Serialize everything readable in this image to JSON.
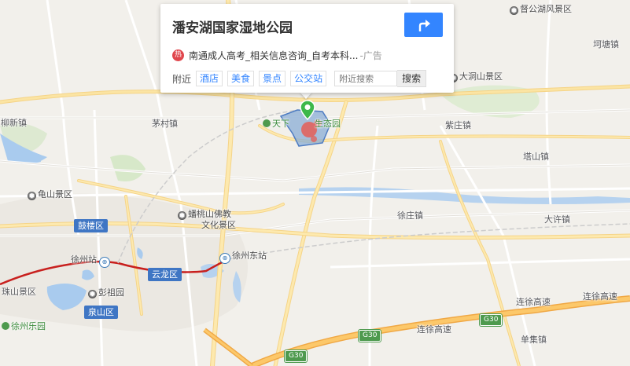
{
  "popup": {
    "title": "潘安湖国家湿地公园",
    "ad_icon": "热",
    "ad_text": "南通成人高考_相关信息咨询_自考本科...",
    "ad_mark": "-广告",
    "nearby_label": "附近",
    "nearby_tags": [
      "酒店",
      "美食",
      "景点",
      "公交站"
    ],
    "search_placeholder": "附近搜索",
    "search_button": "搜索",
    "route_icon": "route-turn-arrow-icon"
  },
  "map": {
    "places": {
      "dugong": "督公湖风景区",
      "kedu": "坷塘镇",
      "dadongshan": "大洞山景区",
      "liuxin": "柳新镇",
      "maocun": "茅村镇",
      "zizhuang": "紫庄镇",
      "tashan": "塔山镇",
      "guishan": "龟山景区",
      "xuzhuang": "徐庄镇",
      "daxu": "大许镇",
      "pitao": "蟠桃山佛教",
      "pitao2": "文化景区",
      "pengzu": "彭祖园",
      "zhushan": "珠山景区",
      "xuzhouleyuan": "徐州乐园",
      "lianxu1": "连徐高速",
      "lianxu2": "连徐高速",
      "lianxu3": "连徐高速",
      "shanji": "单集镇",
      "park_label": "天下",
      "park_label2": "生态园"
    },
    "districts": {
      "gulou": "鼓楼区",
      "yunlong": "云龙区",
      "quanshan": "泉山区"
    },
    "stations": {
      "xuzhou": "徐州站",
      "xuzhoudong": "徐州东站"
    },
    "shields": {
      "g30a": "G30",
      "g30b": "G30",
      "g30c": "G30"
    },
    "colors": {
      "marker": "#3db84a",
      "area_fill": "#8aaed6",
      "highlight": "#e8574f",
      "rail": "#c8201e",
      "accent": "#3385ff"
    }
  }
}
